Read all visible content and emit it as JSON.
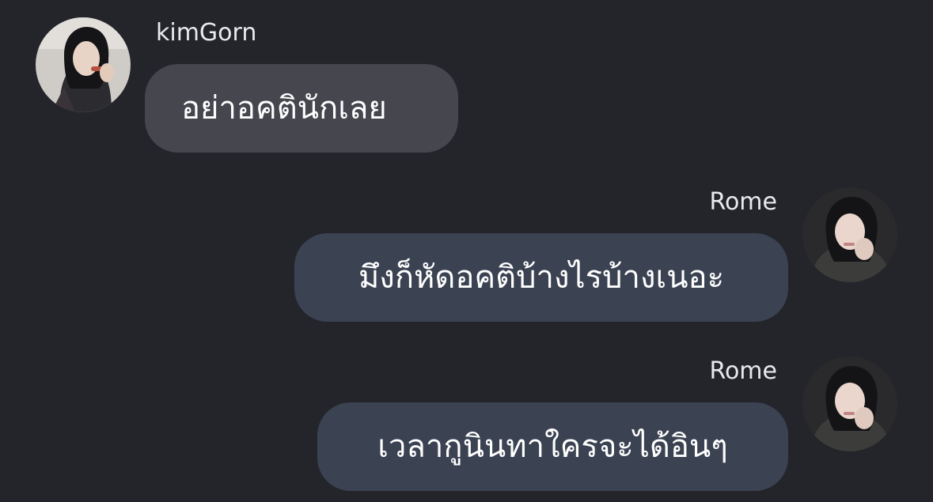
{
  "messages": [
    {
      "sender": "kimGorn",
      "text": "อย่าอคตินักเลย",
      "direction": "incoming",
      "avatar": "avatar-photo-kimgorn"
    },
    {
      "sender": "Rome",
      "text": "มึงก็หัดอคติบ้างไรบ้างเนอะ",
      "direction": "outgoing",
      "avatar": "avatar-photo-rome"
    },
    {
      "sender": "Rome",
      "text": "เวลากูนินทาใครจะได้อินๆ",
      "direction": "outgoing",
      "avatar": "avatar-photo-rome"
    }
  ],
  "colors": {
    "background": "#24252b",
    "incoming_bubble": "#45464e",
    "outgoing_bubble": "#3b4252",
    "sender_text": "#e9e9ee",
    "message_text": "#ffffff"
  }
}
